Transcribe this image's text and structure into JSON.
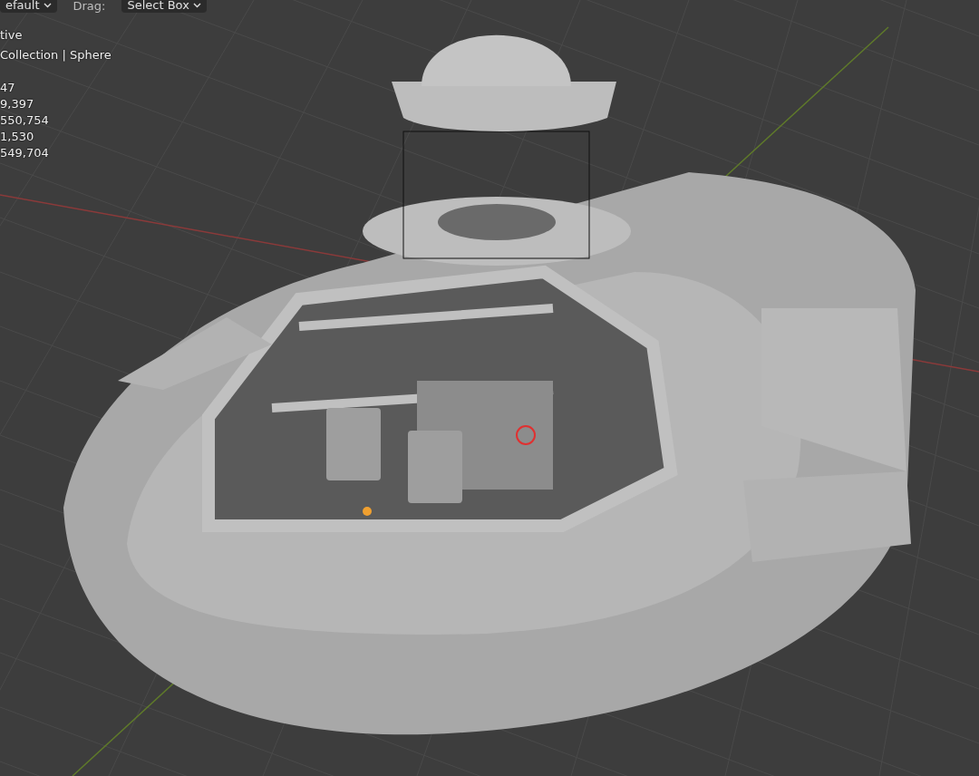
{
  "header": {
    "mode_dropdown": "efault",
    "drag_label": "Drag:",
    "drag_dropdown": "Select Box"
  },
  "overlay": {
    "lines": [
      "tive",
      "Collection | Sphere"
    ],
    "stats": [
      "47",
      "9,397",
      "550,754",
      "1,530",
      "549,704"
    ]
  }
}
